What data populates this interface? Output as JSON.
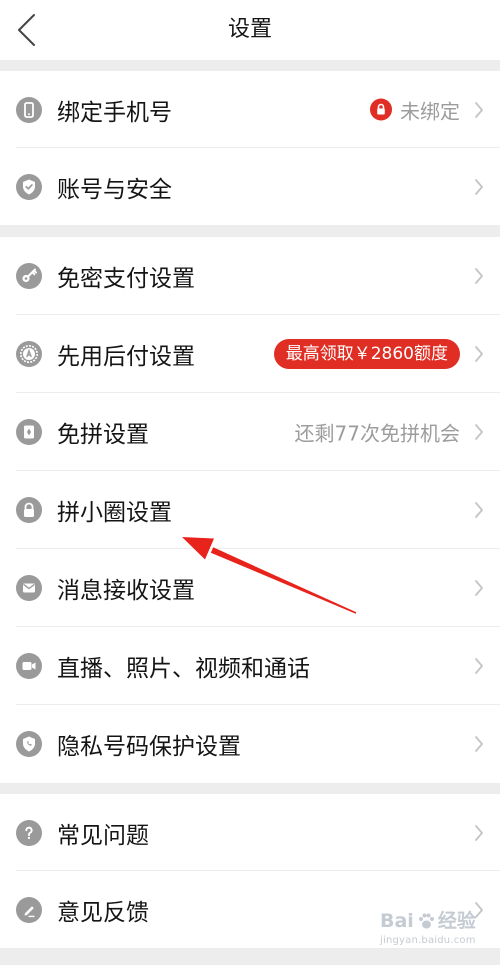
{
  "header": {
    "title": "设置",
    "back_icon": "chevron-left-icon"
  },
  "sections": [
    {
      "items": [
        {
          "label": "绑定手机号",
          "icon": "phone-icon",
          "status_text": "未绑定",
          "status_icon": "lock-icon"
        },
        {
          "label": "账号与安全",
          "icon": "shield-check-icon"
        }
      ]
    },
    {
      "items": [
        {
          "label": "免密支付设置",
          "icon": "key-icon"
        },
        {
          "label": "先用后付设置",
          "icon": "credit-badge-icon",
          "badge": "最高领取￥2860额度"
        },
        {
          "label": "免拼设置",
          "icon": "ticket-icon",
          "status_text": "还剩77次免拼机会"
        },
        {
          "label": "拼小圈设置",
          "icon": "lock-icon"
        },
        {
          "label": "消息接收设置",
          "icon": "mail-icon"
        },
        {
          "label": "直播、照片、视频和通话",
          "icon": "video-camera-icon"
        },
        {
          "label": "隐私号码保护设置",
          "icon": "privacy-shield-icon"
        }
      ]
    },
    {
      "items": [
        {
          "label": "常见问题",
          "icon": "question-icon"
        },
        {
          "label": "意见反馈",
          "icon": "pencil-icon"
        }
      ]
    }
  ],
  "annotation": {
    "icon": "red-arrow-icon",
    "color": "#e8231c"
  },
  "watermark": {
    "brand": "Bai",
    "name": "经验",
    "url": "jingyan.baidu.com"
  },
  "colors": {
    "text": "#151516",
    "secondary_text": "#9c9c9c",
    "icon_background": "#9a9a9a",
    "accent_red": "#e02e24",
    "separator": "#ededed",
    "chevron": "#c4c4c4"
  }
}
